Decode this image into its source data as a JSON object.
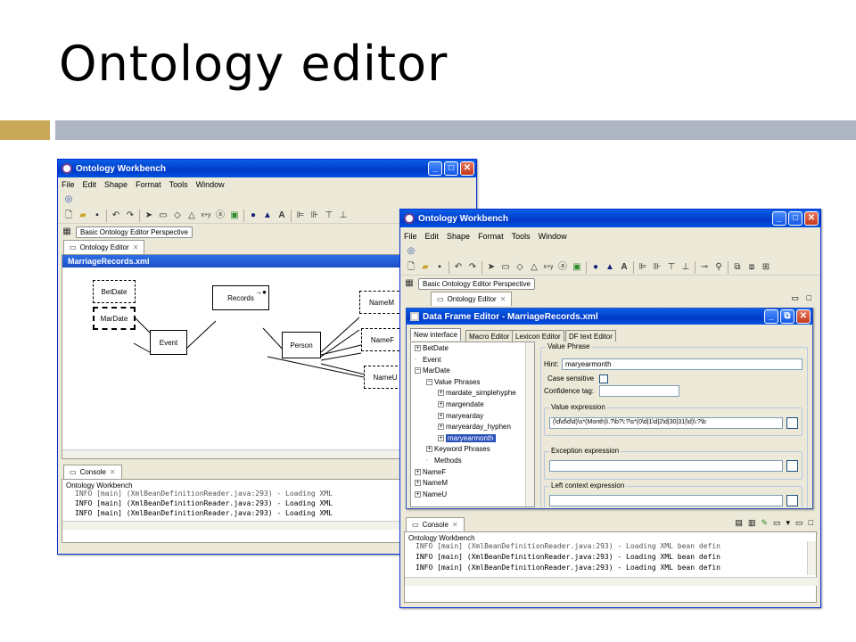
{
  "slide": {
    "title": "Ontology editor"
  },
  "back_window": {
    "title": "Ontology Workbench",
    "menus": [
      "File",
      "Edit",
      "Shape",
      "Format",
      "Tools",
      "Window"
    ],
    "perspective": "Basic Ontology Editor Perspective",
    "view_tab": "Ontology Editor",
    "editor_title": "MarriageRecords.xml",
    "nodes": {
      "betdate": "BetDate",
      "mardate": "MarDate",
      "records": "Records",
      "event": "Event",
      "person": "Person",
      "namem": "NameM",
      "namef": "NameF",
      "nameu": "NameU"
    },
    "console_tab": "Console",
    "console_title": "Ontology Workbench",
    "console_lines": [
      "INFO [main] (XmlBeanDefinitionReader.java:293) - Loading XML",
      "INFO [main] (XmlBeanDefinitionReader.java:293) - Loading XML",
      "INFO [main] (XmlBeanDefinitionReader.java:293) - Loading XML"
    ]
  },
  "front_window": {
    "title": "Ontology Workbench",
    "menus": [
      "File",
      "Edit",
      "Shape",
      "Format",
      "Tools",
      "Window"
    ],
    "perspective": "Basic Ontology Editor Perspective",
    "view_tab": "Ontology Editor",
    "dfe": {
      "title": "Data Frame Editor - MarriageRecords.xml",
      "tabs": [
        "New interface",
        "Macro Editor",
        "Lexicon Editor",
        "DF text Editor"
      ],
      "tree": [
        {
          "label": "BetDate",
          "depth": 0,
          "pm": "+"
        },
        {
          "label": "Event",
          "depth": 0,
          "pm": ""
        },
        {
          "label": "MarDate",
          "depth": 0,
          "pm": "−"
        },
        {
          "label": "Value Phrases",
          "depth": 1,
          "pm": "−"
        },
        {
          "label": "mardate_simplehyphe",
          "depth": 2,
          "pm": "+"
        },
        {
          "label": "margendate",
          "depth": 2,
          "pm": "+"
        },
        {
          "label": "maryearday",
          "depth": 2,
          "pm": "+"
        },
        {
          "label": "maryearday_hyphen",
          "depth": 2,
          "pm": "+"
        },
        {
          "label": "maryearmonth",
          "depth": 2,
          "pm": "+",
          "selected": true
        },
        {
          "label": "Keyword Phrases",
          "depth": 1,
          "pm": "+"
        },
        {
          "label": "Methods",
          "depth": 1,
          "pm": ""
        },
        {
          "label": "NameF",
          "depth": 0,
          "pm": "+"
        },
        {
          "label": "NameM",
          "depth": 0,
          "pm": "+"
        },
        {
          "label": "NameU",
          "depth": 0,
          "pm": "+"
        }
      ],
      "value_phrase_group": "Value Phrase",
      "hint_label": "Hint:",
      "hint_value": "maryearmonth",
      "case_sensitive_label": "Case sensitive",
      "confidence_label": "Confidence tag:",
      "value_expression_group": "Value expression",
      "value_expression": "(\\d\\d\\d\\d)\\s*(Month)\\.?\\b?\\:?\\s*(0\\d|1\\d|2\\d|30|31|\\d)\\:?\\b",
      "exception_group": "Exception expression",
      "left_context_group": "Left context expression"
    },
    "console_tab": "Console",
    "console_title": "Ontology Workbench",
    "console_lines": [
      "INFO [main] (XmlBeanDefinitionReader.java:293) - Loading XML bean defin",
      "INFO [main] (XmlBeanDefinitionReader.java:293) - Loading XML bean defin",
      "INFO [main] (XmlBeanDefinitionReader.java:293) - Loading XML bean defin"
    ]
  },
  "colors": {
    "accent_gold": "#c8a95a",
    "bar_gray": "#aeb5c2",
    "xp_blue": "#0054e3"
  }
}
